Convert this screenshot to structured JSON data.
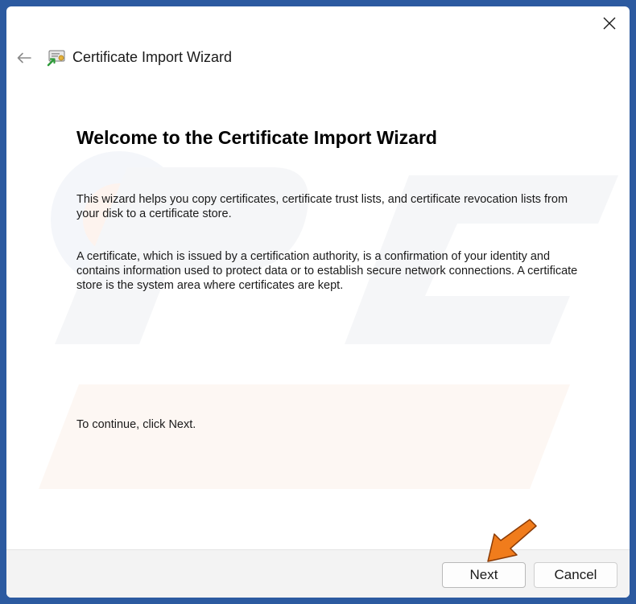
{
  "window": {
    "title": "Certificate Import Wizard"
  },
  "page": {
    "heading": "Welcome to the Certificate Import Wizard",
    "paragraph1": "This wizard helps you copy certificates, certificate trust lists, and certificate revocation lists from your disk to a certificate store.",
    "paragraph2": "A certificate, which is issued by a certification authority, is a confirmation of your identity and contains information used to protect data or to establish secure network connections. A certificate store is the system area where certificates are kept.",
    "paragraph3": "To continue, click Next."
  },
  "buttons": {
    "next_label": "Next",
    "cancel_label": "Cancel"
  },
  "icons": {
    "close": "close-icon",
    "back": "back-arrow-icon",
    "title": "certificate-icon",
    "annotation": "orange-pointer-arrow"
  },
  "colors": {
    "background": "#2c5aa0",
    "window": "#ffffff",
    "footer": "#f3f3f3",
    "annotation_arrow": "#f07c1c"
  }
}
